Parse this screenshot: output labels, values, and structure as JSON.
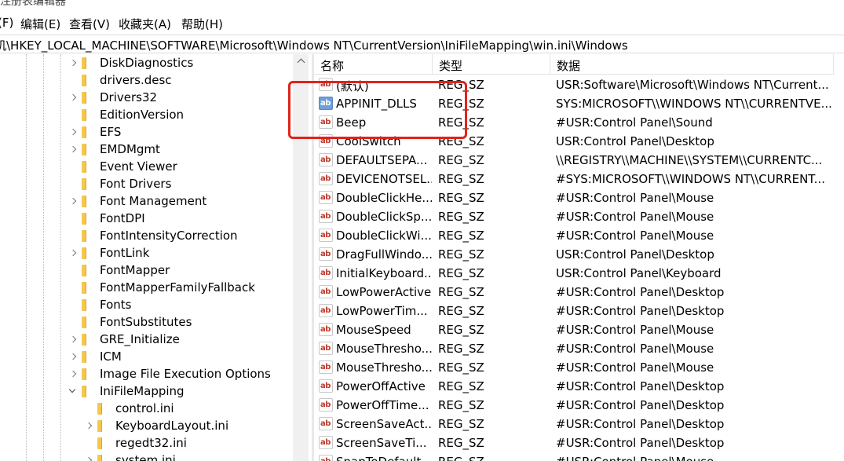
{
  "title": "注册表编辑器",
  "menu": [
    "(F)",
    "编辑(E)",
    "查看(V)",
    "收藏夹(A)",
    "帮助(H)"
  ],
  "address": "计算机\\HKEY_LOCAL_MACHINE\\SOFTWARE\\Microsoft\\Windows NT\\CurrentVersion\\IniFileMapping\\win.ini\\Windows",
  "tree": [
    {
      "label": "DiskDiagnostics",
      "expander": "closed",
      "level": 0
    },
    {
      "label": "drivers.desc",
      "expander": "none",
      "level": 0
    },
    {
      "label": "Drivers32",
      "expander": "closed",
      "level": 0
    },
    {
      "label": "EditionVersion",
      "expander": "none",
      "level": 0
    },
    {
      "label": "EFS",
      "expander": "closed",
      "level": 0
    },
    {
      "label": "EMDMgmt",
      "expander": "closed",
      "level": 0
    },
    {
      "label": "Event Viewer",
      "expander": "none",
      "level": 0
    },
    {
      "label": "Font Drivers",
      "expander": "none",
      "level": 0
    },
    {
      "label": "Font Management",
      "expander": "closed",
      "level": 0
    },
    {
      "label": "FontDPI",
      "expander": "none",
      "level": 0
    },
    {
      "label": "FontIntensityCorrection",
      "expander": "none",
      "level": 0
    },
    {
      "label": "FontLink",
      "expander": "closed",
      "level": 0
    },
    {
      "label": "FontMapper",
      "expander": "none",
      "level": 0
    },
    {
      "label": "FontMapperFamilyFallback",
      "expander": "none",
      "level": 0
    },
    {
      "label": "Fonts",
      "expander": "none",
      "level": 0
    },
    {
      "label": "FontSubstitutes",
      "expander": "none",
      "level": 0
    },
    {
      "label": "GRE_Initialize",
      "expander": "closed",
      "level": 0
    },
    {
      "label": "ICM",
      "expander": "closed",
      "level": 0
    },
    {
      "label": "Image File Execution Options",
      "expander": "closed",
      "level": 0
    },
    {
      "label": "IniFileMapping",
      "expander": "open",
      "level": 0
    },
    {
      "label": "control.ini",
      "expander": "none",
      "level": 1
    },
    {
      "label": "KeyboardLayout.ini",
      "expander": "closed",
      "level": 1
    },
    {
      "label": "regedt32.ini",
      "expander": "none",
      "level": 1
    },
    {
      "label": "system.ini",
      "expander": "closed",
      "level": 1
    }
  ],
  "columns": {
    "name": "名称",
    "type": "类型",
    "data": "数据"
  },
  "values": [
    {
      "name": "(默认)",
      "type": "REG_SZ",
      "data": "USR:Software\\Microsoft\\Windows NT\\Current...",
      "selected": false
    },
    {
      "name": "APPINIT_DLLS",
      "type": "REG_SZ",
      "data": "SYS:MICROSOFT\\\\WINDOWS NT\\\\CURRENTVE...",
      "selected": true
    },
    {
      "name": "Beep",
      "type": "REG_SZ",
      "data": "#USR:Control Panel\\Sound",
      "selected": false
    },
    {
      "name": "CoolSwitch",
      "type": "REG_SZ",
      "data": "USR:Control Panel\\Desktop",
      "selected": false
    },
    {
      "name": "DEFAULTSEPA...",
      "type": "REG_SZ",
      "data": "\\\\REGISTRY\\\\MACHINE\\\\SYSTEM\\\\CURRENTC...",
      "selected": false
    },
    {
      "name": "DEVICENOTSEL...",
      "type": "REG_SZ",
      "data": "#SYS:MICROSOFT\\\\WINDOWS NT\\\\CURRENT...",
      "selected": false
    },
    {
      "name": "DoubleClickHe...",
      "type": "REG_SZ",
      "data": "#USR:Control Panel\\Mouse",
      "selected": false
    },
    {
      "name": "DoubleClickSp...",
      "type": "REG_SZ",
      "data": "#USR:Control Panel\\Mouse",
      "selected": false
    },
    {
      "name": "DoubleClickWi...",
      "type": "REG_SZ",
      "data": "#USR:Control Panel\\Mouse",
      "selected": false
    },
    {
      "name": "DragFullWindo...",
      "type": "REG_SZ",
      "data": "USR:Control Panel\\Desktop",
      "selected": false
    },
    {
      "name": "InitialKeyboard...",
      "type": "REG_SZ",
      "data": "USR:Control Panel\\Keyboard",
      "selected": false
    },
    {
      "name": "LowPowerActive",
      "type": "REG_SZ",
      "data": "#USR:Control Panel\\Desktop",
      "selected": false
    },
    {
      "name": "LowPowerTim...",
      "type": "REG_SZ",
      "data": "#USR:Control Panel\\Desktop",
      "selected": false
    },
    {
      "name": "MouseSpeed",
      "type": "REG_SZ",
      "data": "#USR:Control Panel\\Mouse",
      "selected": false
    },
    {
      "name": "MouseThresho...",
      "type": "REG_SZ",
      "data": "#USR:Control Panel\\Mouse",
      "selected": false
    },
    {
      "name": "MouseThresho...",
      "type": "REG_SZ",
      "data": "#USR:Control Panel\\Mouse",
      "selected": false
    },
    {
      "name": "PowerOffActive",
      "type": "REG_SZ",
      "data": "#USR:Control Panel\\Desktop",
      "selected": false
    },
    {
      "name": "PowerOffTime...",
      "type": "REG_SZ",
      "data": "#USR:Control Panel\\Desktop",
      "selected": false
    },
    {
      "name": "ScreenSaveAct...",
      "type": "REG_SZ",
      "data": "#USR:Control Panel\\Desktop",
      "selected": false
    },
    {
      "name": "ScreenSaveTi...",
      "type": "REG_SZ",
      "data": "#USR:Control Panel\\Desktop",
      "selected": false
    },
    {
      "name": "SnapToDefault...",
      "type": "REG_SZ",
      "data": "#USR:Control Panel\\Mouse",
      "selected": false
    }
  ],
  "icon_text": "ab",
  "colors": {
    "highlight": "#e0231b",
    "folder": "#f5c84c",
    "selected_icon": "#6e9fd8"
  }
}
